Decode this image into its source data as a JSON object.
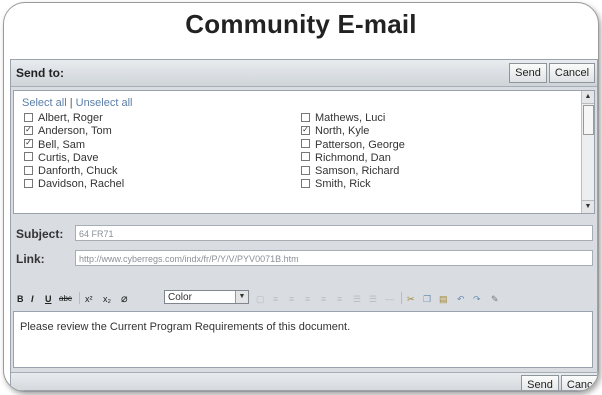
{
  "title": "Community E-mail",
  "send_to": {
    "label": "Send to:",
    "send_label": "Send",
    "cancel_label": "Cancel"
  },
  "recipients": {
    "select_all": "Select all",
    "separator": "|",
    "unselect_all": "Unselect all",
    "left": [
      {
        "name": "Albert, Roger",
        "checked": false
      },
      {
        "name": "Anderson, Tom",
        "checked": true
      },
      {
        "name": "Bell, Sam",
        "checked": true
      },
      {
        "name": "Curtis, Dave",
        "checked": false
      },
      {
        "name": "Danforth, Chuck",
        "checked": false
      },
      {
        "name": "Davidson, Rachel",
        "checked": false
      }
    ],
    "right": [
      {
        "name": "Mathews, Luci",
        "checked": false
      },
      {
        "name": "North, Kyle",
        "checked": true
      },
      {
        "name": "Patterson, George",
        "checked": false
      },
      {
        "name": "Richmond, Dan",
        "checked": false
      },
      {
        "name": "Samson, Richard",
        "checked": false
      },
      {
        "name": "Smith, Rick",
        "checked": false
      }
    ]
  },
  "subject": {
    "label": "Subject:",
    "value": "64 FR71"
  },
  "link": {
    "label": "Link:",
    "value": "http://www.cyberregs.com/indx/fr/P/Y/V/PYV0071B.htm"
  },
  "toolbar": {
    "bold": "B",
    "italic": "I",
    "underline": "U",
    "strike": "abc",
    "superscript": "x²",
    "subscript": "x₂",
    "color_value": "Color"
  },
  "message": {
    "text": "Please review the Current Program Requirements of this document."
  },
  "bottom": {
    "send_label": "Send",
    "cancel_label": "Cancel"
  }
}
